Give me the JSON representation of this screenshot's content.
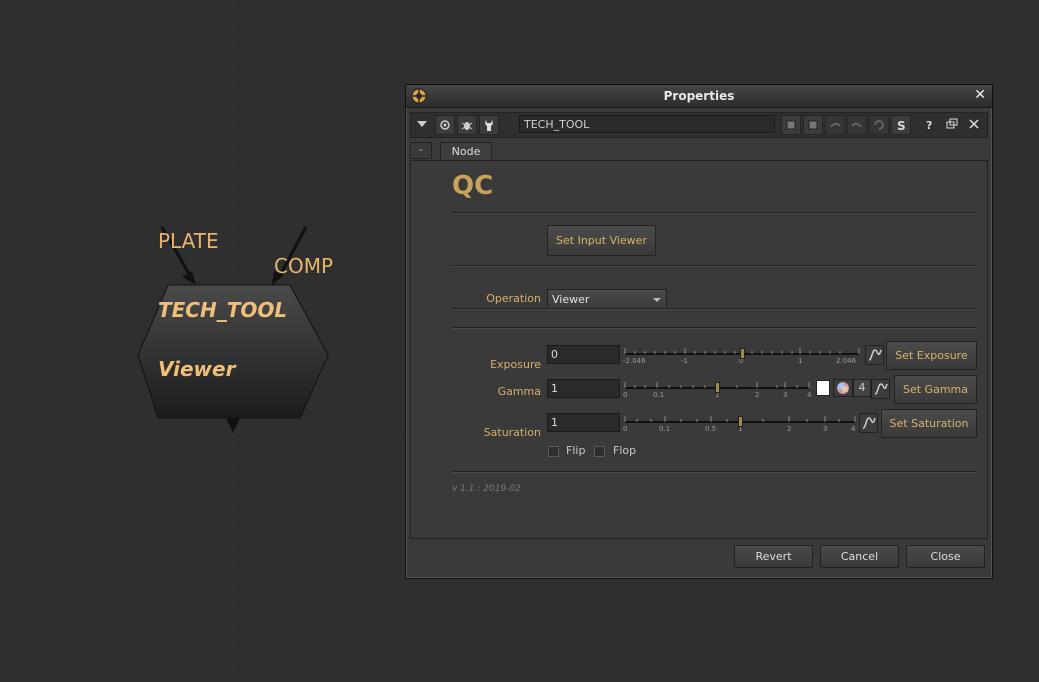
{
  "node_graph": {
    "inputs": [
      "PLATE",
      "COMP"
    ],
    "node": {
      "name": "TECH_TOOL",
      "operation": "Viewer"
    }
  },
  "window": {
    "title": "Properties",
    "node_name_value": "TECH_TOOL",
    "tabs": {
      "collapse": "-",
      "node": "Node"
    },
    "panel": {
      "title": "QC",
      "set_input_viewer": "Set Input Viewer",
      "operation_label": "Operation",
      "operation_value": "Viewer",
      "exposure": {
        "label": "Exposure",
        "value": "0",
        "ticks": [
          "-2.046",
          "-1",
          "0",
          "1",
          "2.046"
        ],
        "button": "Set Exposure"
      },
      "gamma": {
        "label": "Gamma",
        "value": "1",
        "ticks": [
          "0",
          "0.1",
          "1",
          "2",
          "3",
          "4"
        ],
        "channel_value": "4",
        "button": "Set Gamma"
      },
      "saturation": {
        "label": "Saturation",
        "value": "1",
        "ticks": [
          "0",
          "0.1",
          "0.5",
          "1",
          "2",
          "3",
          "4"
        ],
        "button": "Set Saturation"
      },
      "flip": "Flip",
      "flop": "Flop",
      "version": "v 1.1 : 2019-02"
    },
    "footer": {
      "revert": "Revert",
      "cancel": "Cancel",
      "close": "Close"
    }
  }
}
